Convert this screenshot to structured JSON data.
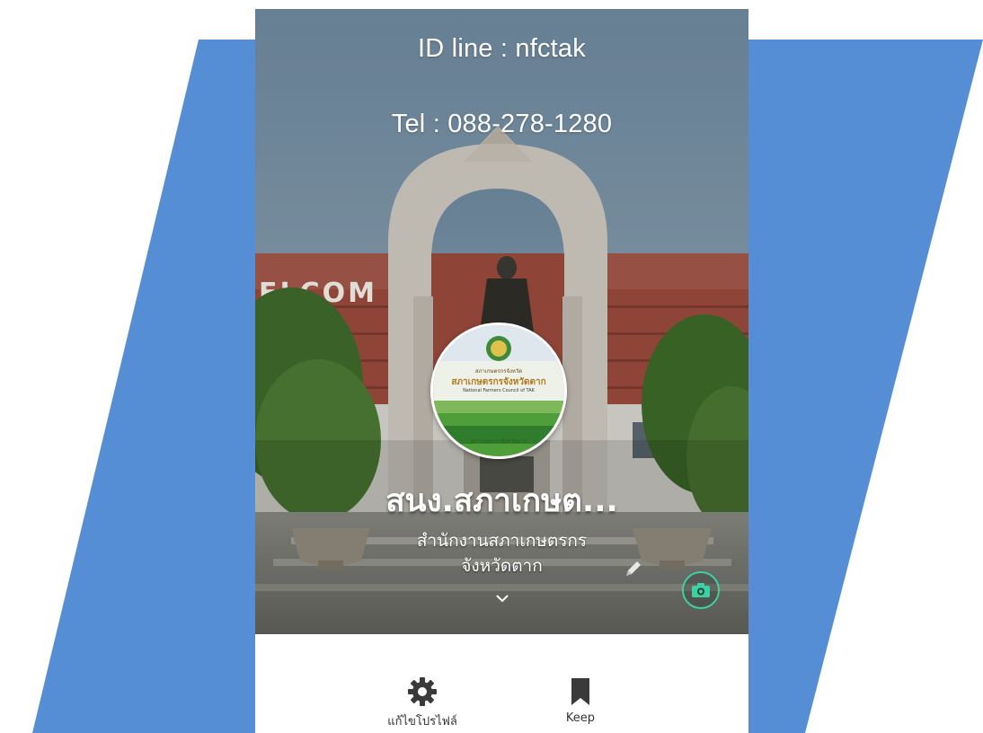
{
  "colors": {
    "accent_blue": "#558ed5",
    "camera_ring": "#3bd1a3"
  },
  "cover": {
    "id_line": "ID line : nfctak",
    "tel": "Tel : 088-278-1280",
    "sign_text": "ELCOM         TO   TA"
  },
  "avatar": {
    "line1": "สภาเกษตรกรจังหวัด",
    "line2": "สภาเกษตรกรจังหวัดตาก",
    "line3": "National Farmers Council of TAK",
    "line4": "สภาเกษตรกรจังหวัดตาก"
  },
  "profile": {
    "name": "สนง.สภาเกษต...",
    "status_line1": "สำนักงานสภาเกษตรกร",
    "status_line2": "จังหวัดตาก"
  },
  "icons": {
    "pencil": "pencil-icon",
    "chevron": "chevron-down-icon",
    "camera": "camera-icon",
    "gear": "gear-icon",
    "bookmark": "bookmark-icon"
  },
  "bottom_bar": {
    "edit_profile_label": "แก้ไขโปรไฟล์",
    "keep_label": "Keep"
  }
}
